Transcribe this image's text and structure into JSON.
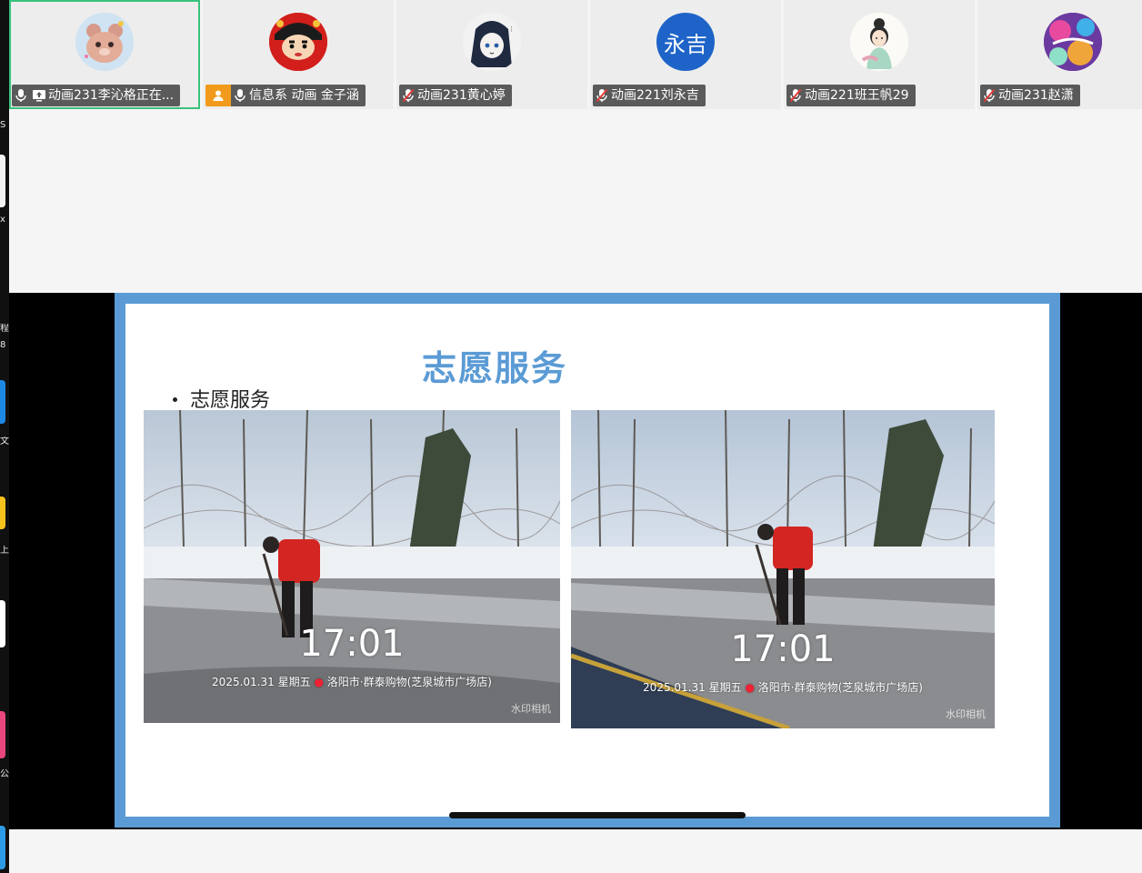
{
  "left_strip": {
    "glyphs": [
      "S",
      "x",
      "程",
      "8",
      "文",
      "上",
      "公"
    ]
  },
  "participants": [
    {
      "name": "动画231李沁格正在...",
      "avatar_icon": "bear-avatar-icon",
      "active": true,
      "mic": "on",
      "sharing": true
    },
    {
      "name": "信息系 动画 金子涵",
      "avatar_icon": "crayon-shin-chan-avatar-icon",
      "host": true,
      "mic": "on"
    },
    {
      "name": "动画231黄心婷",
      "avatar_icon": "anime-girl-avatar-icon",
      "mic": "muted"
    },
    {
      "name": "动画221刘永吉",
      "avatar_text": "永吉",
      "mic": "muted"
    },
    {
      "name": "动画221班王帆29",
      "avatar_icon": "illustrated-girl-avatar-icon",
      "mic": "muted"
    },
    {
      "name": "动画231赵潇",
      "avatar_icon": "colorful-art-avatar-icon",
      "mic": "muted"
    }
  ],
  "slide": {
    "title": "志愿服务",
    "bullet": "志愿服务",
    "photos": [
      {
        "time": "17:01",
        "stamp_date": "2025.01.31",
        "stamp_day": "星期五",
        "stamp_location": "洛阳市·群泰购物(芝泉城市广场店)",
        "watermark": "水印相机"
      },
      {
        "time": "17:01",
        "stamp_date": "2025.01.31",
        "stamp_day": "星期五",
        "stamp_location": "洛阳市·群泰购物(芝泉城市广场店)",
        "watermark": "水印相机"
      }
    ]
  },
  "colors": {
    "slide_frame": "#5b9bd5",
    "title": "#5b9bd5",
    "active_outline": "#39c27d",
    "host_badge": "#f19a1b",
    "text_avatar": "#1e64c8"
  }
}
